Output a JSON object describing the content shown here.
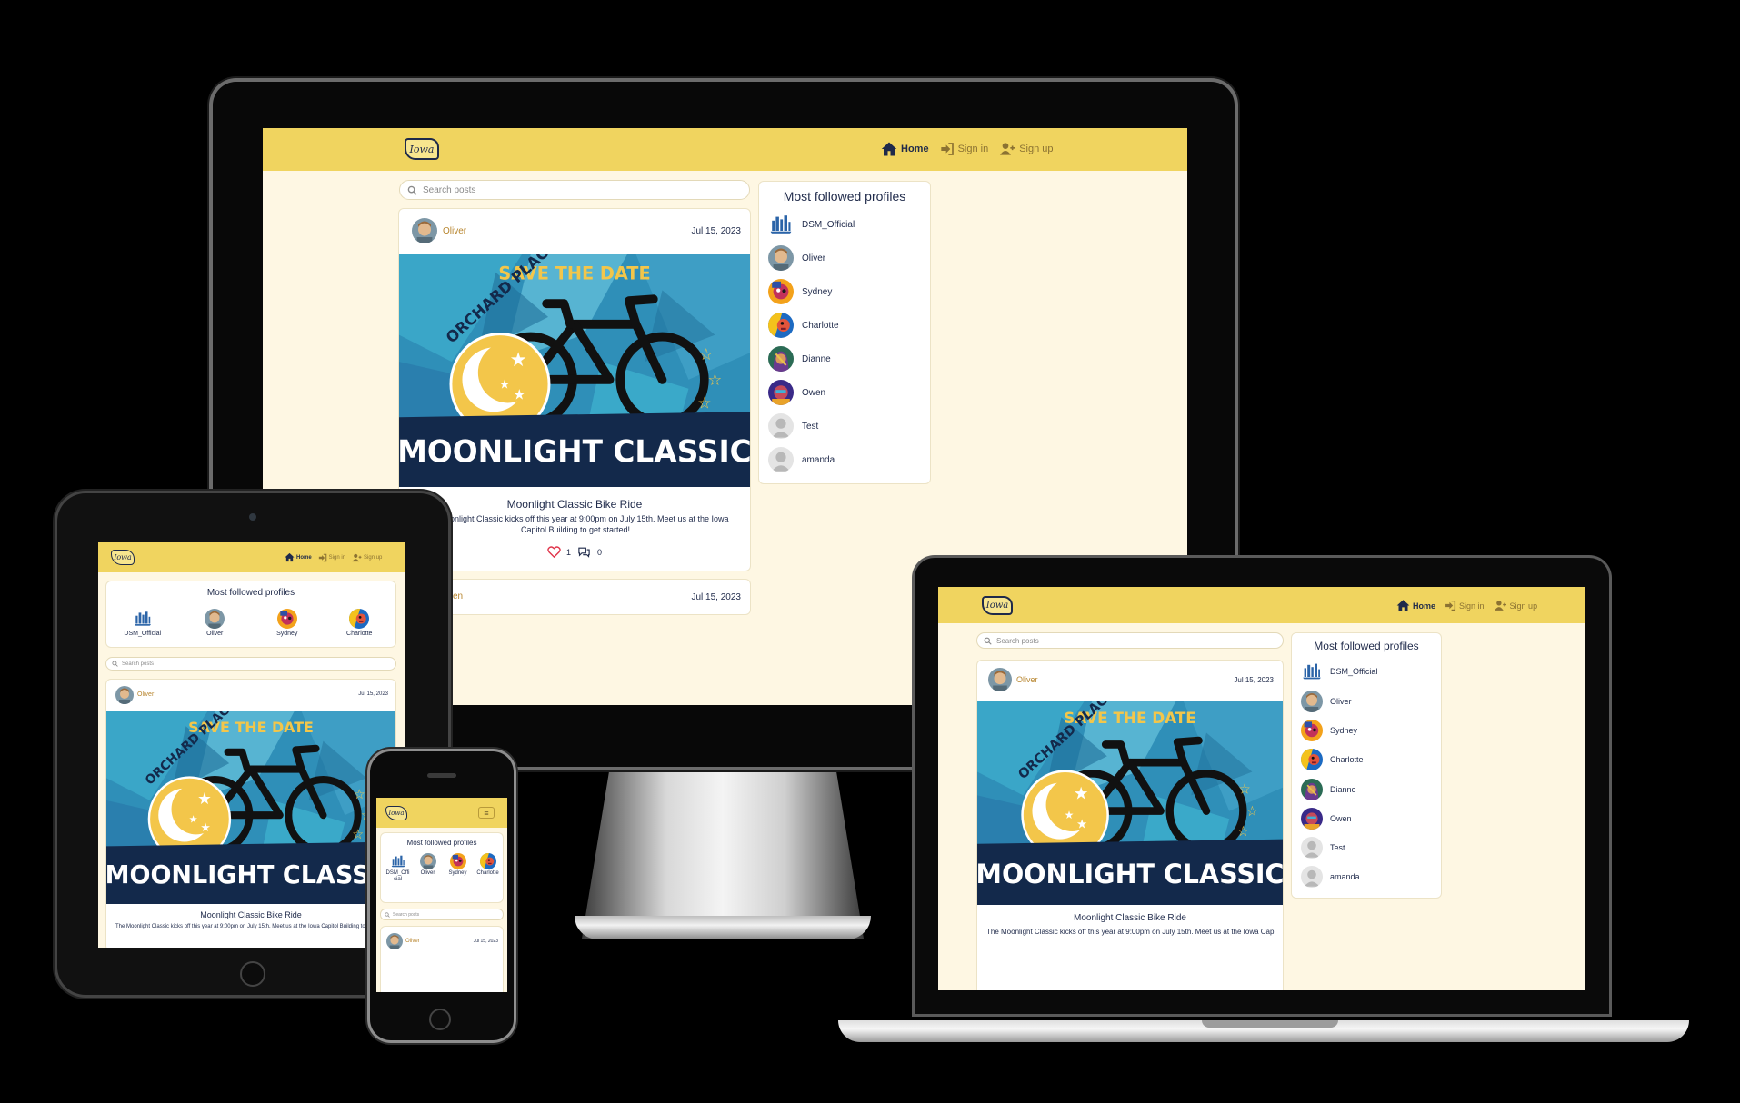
{
  "nav": {
    "logo_text": "Iowa",
    "home_label": "Home",
    "signin_label": "Sign in",
    "signup_label": "Sign up"
  },
  "search": {
    "placeholder": "Search posts"
  },
  "profiles": {
    "title": "Most followed profiles",
    "items": [
      {
        "name": "DSM_Official"
      },
      {
        "name": "Oliver"
      },
      {
        "name": "Sydney"
      },
      {
        "name": "Charlotte"
      },
      {
        "name": "Dianne"
      },
      {
        "name": "Owen"
      },
      {
        "name": "Test"
      },
      {
        "name": "amanda"
      }
    ]
  },
  "posts": [
    {
      "author": "Oliver",
      "date": "Jul 15, 2023",
      "image": {
        "top_text": "SAVE THE DATE",
        "side_text": "ORCHARD PLACE",
        "banner_text": "MOONLIGHT CLASSIC"
      },
      "title": "Moonlight Classic Bike Ride",
      "body": "The Moonlight Classic kicks off this year at 9:00pm on July 15th. Meet us at the Iowa Capitol Building to get started!",
      "likes": "1",
      "comments": "0"
    },
    {
      "author": "Owen",
      "date": "Jul 15, 2023"
    }
  ],
  "phone_profile_labels": [
    "DSM_Official",
    "Oliver",
    "Sydney",
    "Charlotte"
  ],
  "colors": {
    "navbar": "#f0d45f",
    "page_background": "#fef7e3",
    "navy": "#1f2a4a",
    "accent_brown": "#b8862f",
    "like_red": "#e0344a"
  },
  "icons": [
    "home-icon",
    "sign-in-icon",
    "sign-up-icon",
    "search-icon",
    "heart-icon",
    "comment-icon",
    "hamburger-icon"
  ]
}
